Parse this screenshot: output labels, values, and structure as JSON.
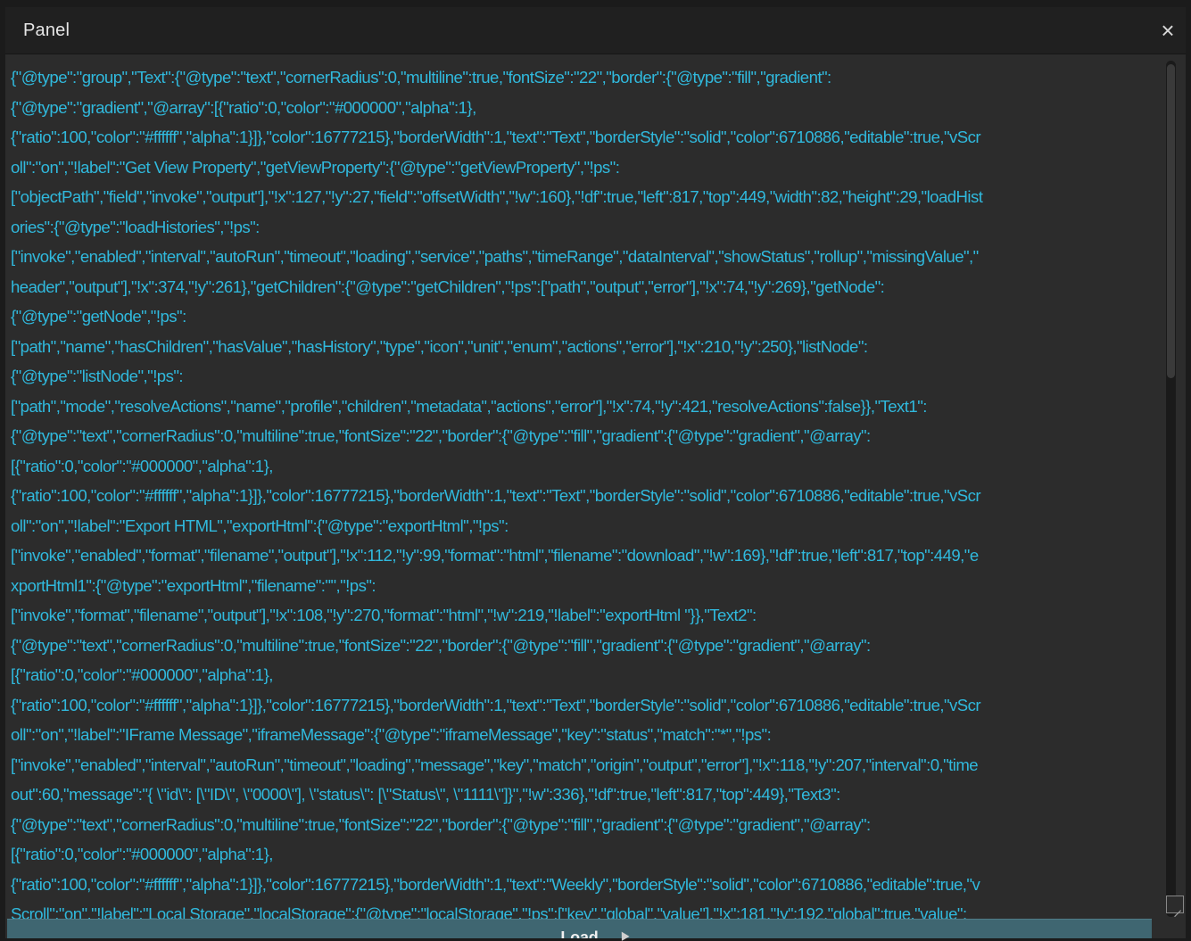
{
  "window": {
    "title": "Panel",
    "close_icon": "close-icon",
    "close_glyph": "×"
  },
  "editor": {
    "lines": [
      "{\"@type\":\"group\",\"Text\":{\"@type\":\"text\",\"cornerRadius\":0,\"multiline\":true,\"fontSize\":\"22\",\"border\":{\"@type\":\"fill\",\"gradient\":",
      "{\"@type\":\"gradient\",\"@array\":[{\"ratio\":0,\"color\":\"#000000\",\"alpha\":1},",
      "{\"ratio\":100,\"color\":\"#ffffff\",\"alpha\":1}]},\"color\":16777215},\"borderWidth\":1,\"text\":\"Text\",\"borderStyle\":\"solid\",\"color\":6710886,\"editable\":true,\"vScr",
      "oll\":\"on\",\"!label\":\"Get View Property\",\"getViewProperty\":{\"@type\":\"getViewProperty\",\"!ps\":",
      "[\"objectPath\",\"field\",\"invoke\",\"output\"],\"!x\":127,\"!y\":27,\"field\":\"offsetWidth\",\"!w\":160},\"!df\":true,\"left\":817,\"top\":449,\"width\":82,\"height\":29,\"loadHist",
      "ories\":{\"@type\":\"loadHistories\",\"!ps\":",
      "[\"invoke\",\"enabled\",\"interval\",\"autoRun\",\"timeout\",\"loading\",\"service\",\"paths\",\"timeRange\",\"dataInterval\",\"showStatus\",\"rollup\",\"missingValue\",\"",
      "header\",\"output\"],\"!x\":374,\"!y\":261},\"getChildren\":{\"@type\":\"getChildren\",\"!ps\":[\"path\",\"output\",\"error\"],\"!x\":74,\"!y\":269},\"getNode\":",
      "{\"@type\":\"getNode\",\"!ps\":",
      "[\"path\",\"name\",\"hasChildren\",\"hasValue\",\"hasHistory\",\"type\",\"icon\",\"unit\",\"enum\",\"actions\",\"error\"],\"!x\":210,\"!y\":250},\"listNode\":",
      "{\"@type\":\"listNode\",\"!ps\":",
      "[\"path\",\"mode\",\"resolveActions\",\"name\",\"profile\",\"children\",\"metadata\",\"actions\",\"error\"],\"!x\":74,\"!y\":421,\"resolveActions\":false}},\"Text1\":",
      "{\"@type\":\"text\",\"cornerRadius\":0,\"multiline\":true,\"fontSize\":\"22\",\"border\":{\"@type\":\"fill\",\"gradient\":{\"@type\":\"gradient\",\"@array\":",
      "[{\"ratio\":0,\"color\":\"#000000\",\"alpha\":1},",
      "{\"ratio\":100,\"color\":\"#ffffff\",\"alpha\":1}]},\"color\":16777215},\"borderWidth\":1,\"text\":\"Text\",\"borderStyle\":\"solid\",\"color\":6710886,\"editable\":true,\"vScr",
      "oll\":\"on\",\"!label\":\"Export HTML\",\"exportHtml\":{\"@type\":\"exportHtml\",\"!ps\":",
      "[\"invoke\",\"enabled\",\"format\",\"filename\",\"output\"],\"!x\":112,\"!y\":99,\"format\":\"html\",\"filename\":\"download\",\"!w\":169},\"!df\":true,\"left\":817,\"top\":449,\"e",
      "xportHtml1\":{\"@type\":\"exportHtml\",\"filename\":\"\",\"!ps\":",
      "[\"invoke\",\"format\",\"filename\",\"output\"],\"!x\":108,\"!y\":270,\"format\":\"html\",\"!w\":219,\"!label\":\"exportHtml \"}},\"Text2\":",
      "{\"@type\":\"text\",\"cornerRadius\":0,\"multiline\":true,\"fontSize\":\"22\",\"border\":{\"@type\":\"fill\",\"gradient\":{\"@type\":\"gradient\",\"@array\":",
      "[{\"ratio\":0,\"color\":\"#000000\",\"alpha\":1},",
      "{\"ratio\":100,\"color\":\"#ffffff\",\"alpha\":1}]},\"color\":16777215},\"borderWidth\":1,\"text\":\"Text\",\"borderStyle\":\"solid\",\"color\":6710886,\"editable\":true,\"vScr",
      "oll\":\"on\",\"!label\":\"IFrame Message\",\"iframeMessage\":{\"@type\":\"iframeMessage\",\"key\":\"status\",\"match\":\"*\",\"!ps\":",
      "[\"invoke\",\"enabled\",\"interval\",\"autoRun\",\"timeout\",\"loading\",\"message\",\"key\",\"match\",\"origin\",\"output\",\"error\"],\"!x\":118,\"!y\":207,\"interval\":0,\"time",
      "out\":60,\"message\":\"{ \\\"id\\\": [\\\"ID\\\", \\\"0000\\\"], \\\"status\\\": [\\\"Status\\\", \\\"1111\\\"]}\",\"!w\":336},\"!df\":true,\"left\":817,\"top\":449},\"Text3\":",
      "{\"@type\":\"text\",\"cornerRadius\":0,\"multiline\":true,\"fontSize\":\"22\",\"border\":{\"@type\":\"fill\",\"gradient\":{\"@type\":\"gradient\",\"@array\":",
      "[{\"ratio\":0,\"color\":\"#000000\",\"alpha\":1},",
      "{\"ratio\":100,\"color\":\"#ffffff\",\"alpha\":1}]},\"color\":16777215},\"borderWidth\":1,\"text\":\"Weekly\",\"borderStyle\":\"solid\",\"color\":6710886,\"editable\":true,\"v",
      "Scroll\":\"on\",\"!label\":\"Local Storage\",\"localStorage\":{\"@type\":\"localStorage\",\"!ps\":[\"key\",\"global\",\"value\"],\"!x\":181,\"!y\":192,\"global\":true,\"value\":"
    ]
  },
  "footer": {
    "load_label": "Load",
    "dots": ".."
  },
  "colors": {
    "text": "#30b9dd",
    "panel_bg": "#2c2c2c",
    "titlebar_bg": "#202020",
    "load_bar": "#3f6671"
  }
}
